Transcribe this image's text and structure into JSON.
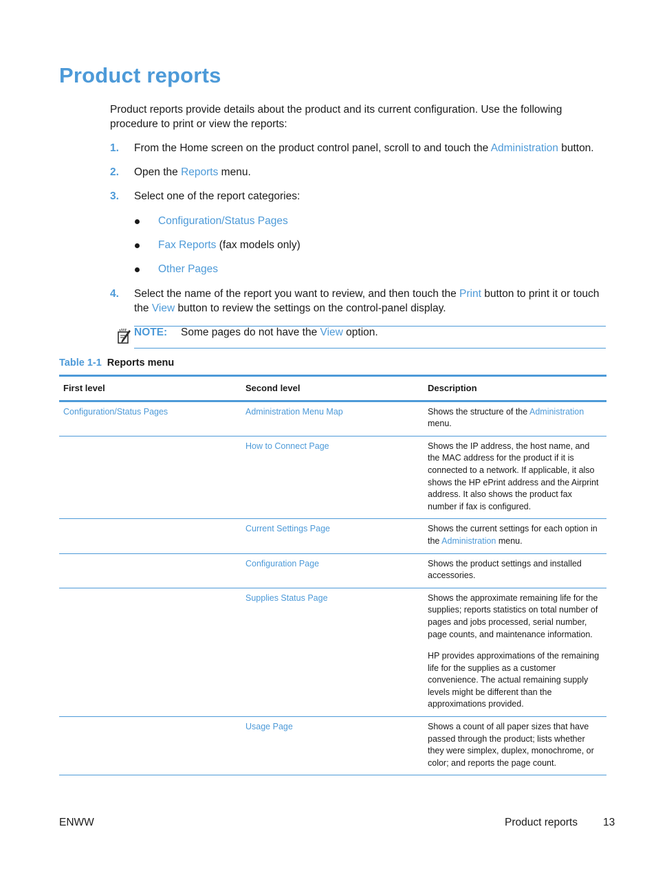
{
  "title": "Product reports",
  "intro": "Product reports provide details about the product and its current configuration. Use the following procedure to print or view the reports:",
  "steps": [
    {
      "num": "1.",
      "pre": "From the Home screen on the product control panel, scroll to and touch the ",
      "link": "Administration",
      "post": " button."
    },
    {
      "num": "2.",
      "pre": "Open the ",
      "link": "Reports",
      "post": " menu."
    },
    {
      "num": "3.",
      "text": "Select one of the report categories:"
    },
    {
      "num": "4.",
      "pre": "Select the name of the report you want to review, and then touch the ",
      "link": "Print",
      "mid": " button to print it or touch the ",
      "link2": "View",
      "post": " button to review the settings on the control-panel display."
    }
  ],
  "categories": [
    {
      "link": "Configuration/Status Pages",
      "suffix": ""
    },
    {
      "link": "Fax Reports",
      "suffix": " (fax models only)"
    },
    {
      "link": "Other Pages",
      "suffix": ""
    }
  ],
  "note": {
    "label": "NOTE:",
    "pre": "Some pages do not have the ",
    "link": "View",
    "post": " option.",
    "icon": "note-pencil-icon"
  },
  "table": {
    "caption_num": "Table 1-1",
    "caption_title": "Reports menu",
    "headers": [
      "First level",
      "Second level",
      "Description"
    ],
    "rows": [
      {
        "first": "Configuration/Status Pages",
        "second": "Administration Menu Map",
        "desc": [
          {
            "pre": "Shows the structure of the ",
            "link": "Administration",
            "post": " menu."
          }
        ]
      },
      {
        "first": "",
        "second": "How to Connect Page",
        "desc": [
          {
            "pre": "Shows the IP address, the host name, and the MAC address for the product if it is connected to a network. If applicable, it also shows the HP ePrint address and the Airprint address. It also shows the product fax number if fax is configured."
          }
        ]
      },
      {
        "first": "",
        "second": "Current Settings Page",
        "desc": [
          {
            "pre": "Shows the current settings for each option in the ",
            "link": "Administration",
            "post": " menu."
          }
        ]
      },
      {
        "first": "",
        "second": "Configuration Page",
        "desc": [
          {
            "pre": "Shows the product settings and installed accessories."
          }
        ]
      },
      {
        "first": "",
        "second": "Supplies Status Page",
        "desc": [
          {
            "pre": "Shows the approximate remaining life for the supplies; reports statistics on total number of pages and jobs processed, serial number, page counts, and maintenance information."
          },
          {
            "pre": "HP provides approximations of the remaining life for the supplies as a customer convenience. The actual remaining supply levels might be different than the approximations provided."
          }
        ]
      },
      {
        "first": "",
        "second": "Usage Page",
        "desc": [
          {
            "pre": "Shows a count of all paper sizes that have passed through the product; lists whether they were simplex, duplex, monochrome, or color; and reports the page count."
          }
        ]
      }
    ]
  },
  "footer": {
    "left": "ENWW",
    "section": "Product reports",
    "page": "13"
  }
}
